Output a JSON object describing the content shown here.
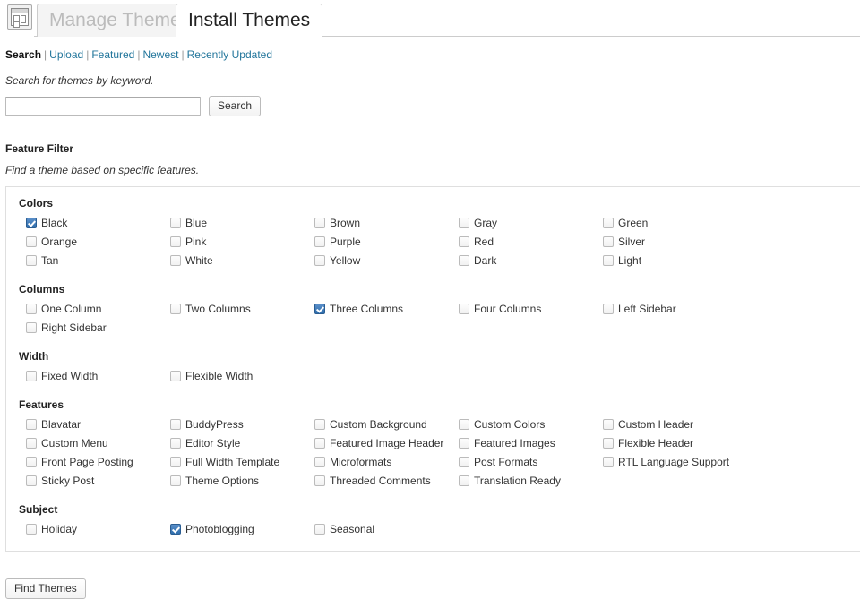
{
  "header": {
    "icon": "appearance-icon",
    "tabs": [
      {
        "label": "Manage Themes",
        "active": false
      },
      {
        "label": "Install Themes",
        "active": true
      }
    ]
  },
  "nav": {
    "current": "Search",
    "separator": "|",
    "links": [
      "Upload",
      "Featured",
      "Newest",
      "Recently Updated"
    ]
  },
  "search": {
    "description": "Search for themes by keyword.",
    "value": "",
    "placeholder": "",
    "button_label": "Search"
  },
  "feature_filter": {
    "title": "Feature Filter",
    "description": "Find a theme based on specific features.",
    "groups": [
      {
        "title": "Colors",
        "options": [
          {
            "label": "Black",
            "checked": true
          },
          {
            "label": "Blue",
            "checked": false
          },
          {
            "label": "Brown",
            "checked": false
          },
          {
            "label": "Gray",
            "checked": false
          },
          {
            "label": "Green",
            "checked": false
          },
          {
            "label": "Orange",
            "checked": false
          },
          {
            "label": "Pink",
            "checked": false
          },
          {
            "label": "Purple",
            "checked": false
          },
          {
            "label": "Red",
            "checked": false
          },
          {
            "label": "Silver",
            "checked": false
          },
          {
            "label": "Tan",
            "checked": false
          },
          {
            "label": "White",
            "checked": false
          },
          {
            "label": "Yellow",
            "checked": false
          },
          {
            "label": "Dark",
            "checked": false
          },
          {
            "label": "Light",
            "checked": false
          }
        ]
      },
      {
        "title": "Columns",
        "options": [
          {
            "label": "One Column",
            "checked": false
          },
          {
            "label": "Two Columns",
            "checked": false
          },
          {
            "label": "Three Columns",
            "checked": true
          },
          {
            "label": "Four Columns",
            "checked": false
          },
          {
            "label": "Left Sidebar",
            "checked": false
          },
          {
            "label": "Right Sidebar",
            "checked": false
          }
        ]
      },
      {
        "title": "Width",
        "options": [
          {
            "label": "Fixed Width",
            "checked": false
          },
          {
            "label": "Flexible Width",
            "checked": false
          }
        ]
      },
      {
        "title": "Features",
        "options": [
          {
            "label": "Blavatar",
            "checked": false
          },
          {
            "label": "BuddyPress",
            "checked": false
          },
          {
            "label": "Custom Background",
            "checked": false
          },
          {
            "label": "Custom Colors",
            "checked": false
          },
          {
            "label": "Custom Header",
            "checked": false
          },
          {
            "label": "Custom Menu",
            "checked": false
          },
          {
            "label": "Editor Style",
            "checked": false
          },
          {
            "label": "Featured Image Header",
            "checked": false
          },
          {
            "label": "Featured Images",
            "checked": false
          },
          {
            "label": "Flexible Header",
            "checked": false
          },
          {
            "label": "Front Page Posting",
            "checked": false
          },
          {
            "label": "Full Width Template",
            "checked": false
          },
          {
            "label": "Microformats",
            "checked": false
          },
          {
            "label": "Post Formats",
            "checked": false
          },
          {
            "label": "RTL Language Support",
            "checked": false
          },
          {
            "label": "Sticky Post",
            "checked": false
          },
          {
            "label": "Theme Options",
            "checked": false
          },
          {
            "label": "Threaded Comments",
            "checked": false
          },
          {
            "label": "Translation Ready",
            "checked": false
          }
        ]
      },
      {
        "title": "Subject",
        "options": [
          {
            "label": "Holiday",
            "checked": false
          },
          {
            "label": "Photoblogging",
            "checked": true
          },
          {
            "label": "Seasonal",
            "checked": false
          }
        ]
      }
    ]
  },
  "footer": {
    "find_themes_label": "Find Themes"
  },
  "colors": {
    "link": "#21759b",
    "checkbox_checked": "#2f6ead",
    "panel_border": "#dfdfdf",
    "tab_border": "#cccccc",
    "inactive_tab_text": "#bbbbbb"
  }
}
